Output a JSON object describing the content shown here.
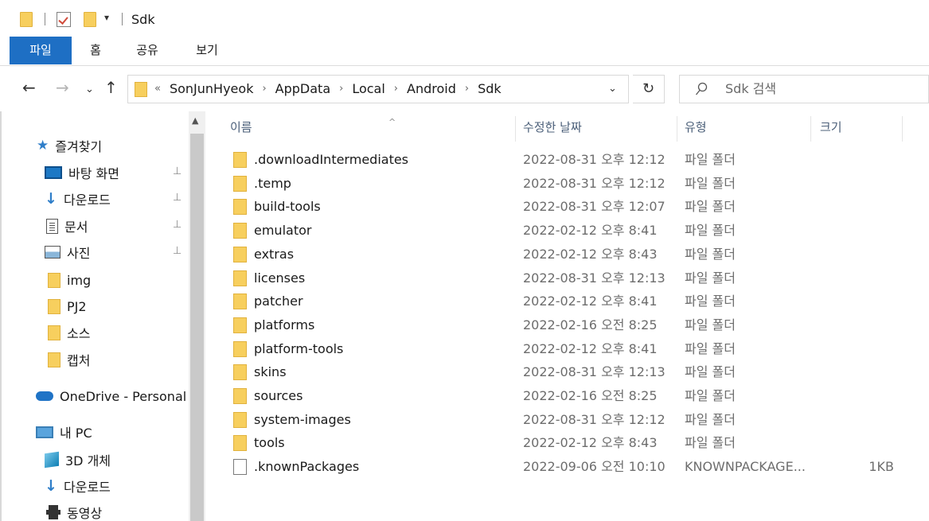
{
  "window": {
    "title": "Sdk",
    "qat_dropdown": "▾"
  },
  "ribbon": {
    "tabs": [
      "파일",
      "홈",
      "공유",
      "보기"
    ]
  },
  "toolbar": {
    "back": "←",
    "forward": "→",
    "recent": "⌄",
    "up": "↑",
    "address": {
      "overflow": "«",
      "crumbs": [
        "SonJunHyeok",
        "AppData",
        "Local",
        "Android",
        "Sdk"
      ],
      "separator": "›",
      "chevron": "⌄"
    },
    "refresh": "↻",
    "search": {
      "placeholder": "Sdk 검색"
    }
  },
  "sidebar": {
    "scroll_up": "▲",
    "items": [
      {
        "label": "즐겨찾기",
        "icon": "star-icon"
      },
      {
        "label": "바탕 화면",
        "icon": "desktop-icon",
        "pinned": true
      },
      {
        "label": "다운로드",
        "icon": "download-icon",
        "pinned": true
      },
      {
        "label": "문서",
        "icon": "document-icon",
        "pinned": true
      },
      {
        "label": "사진",
        "icon": "pictures-icon",
        "pinned": true
      },
      {
        "label": "img",
        "icon": "folder-icon"
      },
      {
        "label": "PJ2",
        "icon": "folder-icon"
      },
      {
        "label": "소스",
        "icon": "folder-icon"
      },
      {
        "label": "캡처",
        "icon": "folder-icon"
      },
      {
        "label": "OneDrive - Personal",
        "icon": "onedrive-icon"
      },
      {
        "label": "내 PC",
        "icon": "pc-icon"
      },
      {
        "label": "3D 개체",
        "icon": "3d-objects-icon"
      },
      {
        "label": "다운로드",
        "icon": "download-icon"
      },
      {
        "label": "동영상",
        "icon": "video-icon"
      }
    ],
    "pin_glyph": "📌"
  },
  "columns": {
    "name": "이름",
    "date": "수정한 날짜",
    "type": "유형",
    "size": "크기",
    "sort": "^"
  },
  "files": [
    {
      "name": ".downloadIntermediates",
      "date": "2022-08-31 오후 12:12",
      "type": "파일 폴더",
      "size": "",
      "kind": "folder"
    },
    {
      "name": ".temp",
      "date": "2022-08-31 오후 12:12",
      "type": "파일 폴더",
      "size": "",
      "kind": "folder"
    },
    {
      "name": "build-tools",
      "date": "2022-08-31 오후 12:07",
      "type": "파일 폴더",
      "size": "",
      "kind": "folder"
    },
    {
      "name": "emulator",
      "date": "2022-02-12 오후 8:41",
      "type": "파일 폴더",
      "size": "",
      "kind": "folder"
    },
    {
      "name": "extras",
      "date": "2022-02-12 오후 8:43",
      "type": "파일 폴더",
      "size": "",
      "kind": "folder"
    },
    {
      "name": "licenses",
      "date": "2022-08-31 오후 12:13",
      "type": "파일 폴더",
      "size": "",
      "kind": "folder"
    },
    {
      "name": "patcher",
      "date": "2022-02-12 오후 8:41",
      "type": "파일 폴더",
      "size": "",
      "kind": "folder"
    },
    {
      "name": "platforms",
      "date": "2022-02-16 오전 8:25",
      "type": "파일 폴더",
      "size": "",
      "kind": "folder"
    },
    {
      "name": "platform-tools",
      "date": "2022-02-12 오후 8:41",
      "type": "파일 폴더",
      "size": "",
      "kind": "folder"
    },
    {
      "name": "skins",
      "date": "2022-08-31 오후 12:13",
      "type": "파일 폴더",
      "size": "",
      "kind": "folder"
    },
    {
      "name": "sources",
      "date": "2022-02-16 오전 8:25",
      "type": "파일 폴더",
      "size": "",
      "kind": "folder"
    },
    {
      "name": "system-images",
      "date": "2022-08-31 오후 12:12",
      "type": "파일 폴더",
      "size": "",
      "kind": "folder"
    },
    {
      "name": "tools",
      "date": "2022-02-12 오후 8:43",
      "type": "파일 폴더",
      "size": "",
      "kind": "folder"
    },
    {
      "name": ".knownPackages",
      "date": "2022-09-06 오전 10:10",
      "type": "KNOWNPACKAGE...",
      "size": "1KB",
      "kind": "file"
    }
  ],
  "colors": {
    "file_tab": "#1e6fc4",
    "folder": "#f7cf5e",
    "header_text": "#4c607a"
  }
}
